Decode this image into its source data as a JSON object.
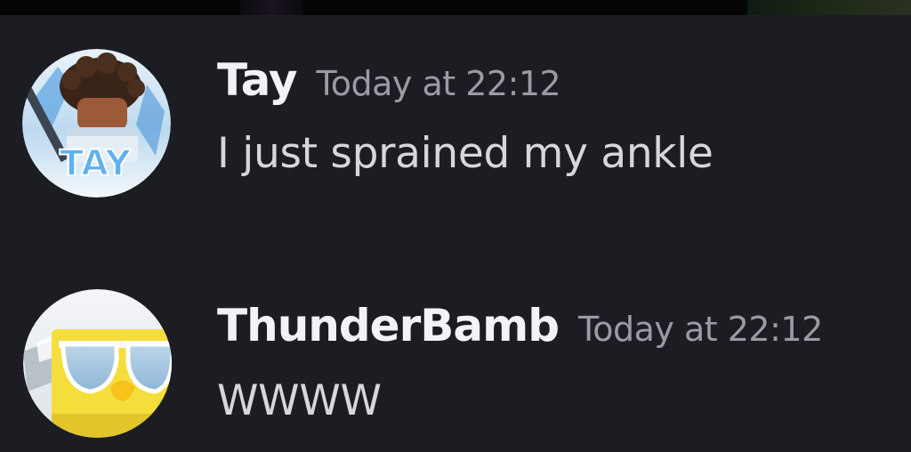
{
  "messages": [
    {
      "username": "Tay",
      "timestamp": "Today at 22:12",
      "content": "I just sprained my ankle",
      "avatar_text": "TAY"
    },
    {
      "username": "ThunderBamb",
      "timestamp": "Today at 22:12",
      "content": "WWWW"
    }
  ],
  "colors": {
    "background": "#1c1d22",
    "username": "#f2f3f5",
    "timestamp": "#9a9ba3",
    "message_text": "#d6d7dc"
  }
}
